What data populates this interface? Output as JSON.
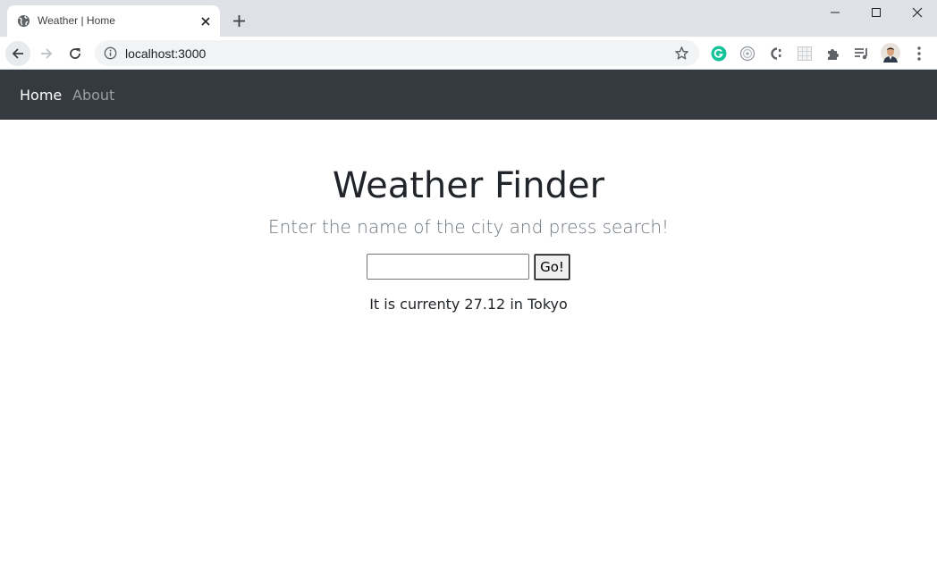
{
  "browser": {
    "tab_title": "Weather | Home",
    "url": "localhost:3000",
    "icons": {
      "favicon": "globe-icon",
      "tab_close": "close-icon",
      "new_tab": "plus-icon",
      "back": "arrow-left-icon",
      "forward": "arrow-right-icon",
      "reload": "reload-icon",
      "site_info": "info-icon",
      "bookmark": "star-icon",
      "extensions": [
        "grammarly-icon",
        "target-icon",
        "extension-c-icon",
        "grid-extension-icon",
        "puzzle-icon",
        "media-queue-icon"
      ],
      "menu": "kebab-menu-icon"
    },
    "accent": "#15c39a"
  },
  "site_nav": {
    "items": [
      {
        "label": "Home",
        "active": true
      },
      {
        "label": "About",
        "active": false
      }
    ],
    "background": "#343a40"
  },
  "main": {
    "title": "Weather Finder",
    "subtitle": "Enter the name of the city and press search!",
    "search": {
      "value": "",
      "placeholder": "",
      "button_label": "Go!"
    },
    "result": "It is currenty 27.12 in Tokyo"
  }
}
